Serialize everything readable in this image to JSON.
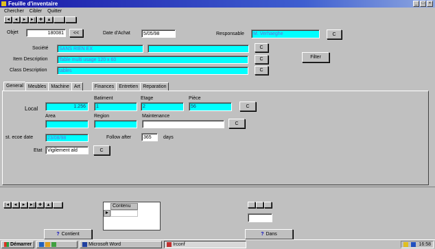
{
  "window": {
    "title": "Feuille d'inventaire",
    "controls": [
      "minimize-icon",
      "maximize-icon",
      "close-icon"
    ]
  },
  "menu": [
    "Chercher",
    "Cibler",
    "Quitter"
  ],
  "toolbar": {
    "nav": [
      "|◄",
      "◄",
      "►",
      "►|",
      "✚",
      "▲"
    ]
  },
  "header": {
    "objet_label": "Objet",
    "objet_value": "180081",
    "objet_button": "<<",
    "date_label": "Date d'Achat",
    "date_value": "5/05/98",
    "responsable_label": "Responsable",
    "responsable_value": "M. Verhaeghe",
    "responsable_button": "C",
    "societe_label": "Société",
    "societe_value": "SANS RIEN EX",
    "societe_button": "C",
    "item_label": "Item Description",
    "item_value": "Table multi usage 120 x 60",
    "item_button": "C",
    "class_label": "Class Description",
    "class_value": "tables",
    "class_button": "C",
    "filter_button": "Filter"
  },
  "tabs": [
    "General",
    "Meubles",
    "Machine",
    "Art",
    "Finances",
    "Entretien",
    "Reparation"
  ],
  "general": {
    "local_label": "Local",
    "local_value": "1.256",
    "batiment_label": "Batiment",
    "batiment_value": "1",
    "etage_label": "Etage",
    "etage_value": "2",
    "piece_label": "Pièce",
    "piece_value": "56",
    "local_button": "C",
    "area_label": "Area",
    "region_label": "Region",
    "maintenance_label": "Maintenance",
    "maintenance_button": "C",
    "last_date_label": "st. ecoe date",
    "last_date_value": "23/08/98",
    "follow_label": "Follow after",
    "follow_value": "365",
    "days_label": "days",
    "etat_label": "Etat",
    "etat_value": "Vigilement ald",
    "etat_button": "C"
  },
  "subform": {
    "column_header": "Contenu",
    "selector": "►"
  },
  "bottom": {
    "contient_button": "Contient",
    "dans_button": "Dans",
    "help_icon": "question-icon"
  },
  "taskbar": {
    "start": "Démarrer",
    "items": [
      "Microsoft Word",
      "Irconf"
    ],
    "clock": "16:58"
  }
}
